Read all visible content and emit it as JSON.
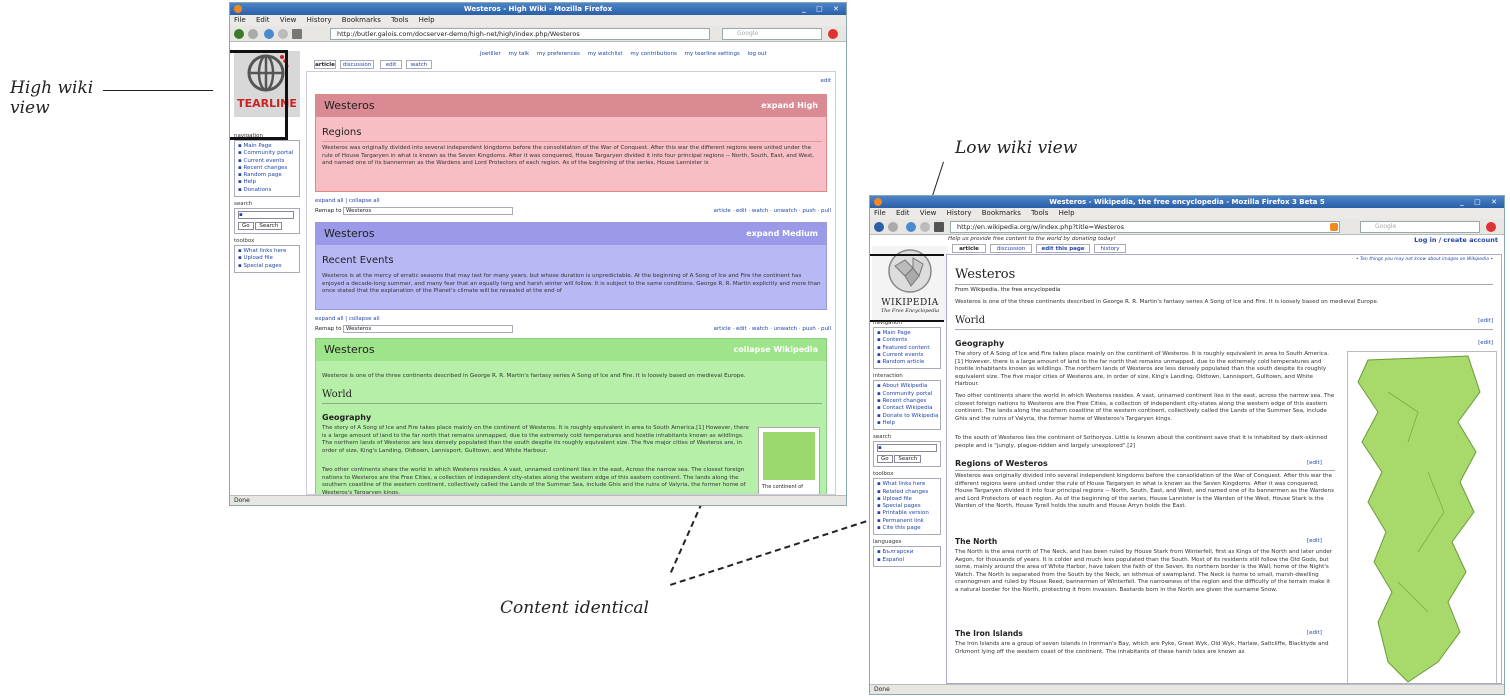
{
  "annotations": {
    "high_wiki": "High wiki view",
    "low_wiki": "Low wiki view",
    "content_identical": "Content identical"
  },
  "high_window": {
    "title": "Westeros - High Wiki - Mozilla Firefox",
    "menu": [
      "File",
      "Edit",
      "View",
      "History",
      "Bookmarks",
      "Tools",
      "Help"
    ],
    "url": "http://butler.galois.com/docserver-demo/high-net/high/index.php/Westeros",
    "search_placeholder": "Google",
    "user_links": [
      "Joetiller",
      "my talk",
      "my preferences",
      "my watchlist",
      "my contributions",
      "my tearline settings",
      "log out"
    ],
    "tabs": [
      "article",
      "discussion",
      "edit",
      "watch"
    ],
    "logo_text": "TEARLINE",
    "edit_link": "edit",
    "nav_header": "navigation",
    "nav_items": [
      "Main Page",
      "Community portal",
      "Current events",
      "Recent changes",
      "Random page",
      "Help",
      "Donations"
    ],
    "search_header": "search",
    "go_label": "Go",
    "search_label": "Search",
    "toolbox_header": "toolbox",
    "toolbox_items": [
      "What links here",
      "Upload file",
      "Special pages"
    ],
    "status": "Done",
    "high": {
      "title": "Westeros",
      "expand": "expand High",
      "heading": "Regions",
      "text": "Westeros was originally divided into several independent kingdoms before the consolidation of the War of Conquest. After this war the different regions were united under the rule of House Targaryen in what is known as the Seven Kingdoms. After it was conquered, House Targaryen divided it into four principal regions -- North, South, East, and West, and named one of its bannermen as the Wardens and Lord Protectors of each region. As of the beginning of the series, House Lannister is"
    },
    "expand_all": "expand all | collapse all",
    "remap_label": "Remap to",
    "remap_value": "Westeros",
    "remap_actions": "article · edit · watch · unwatch · push · pull",
    "medium": {
      "title": "Westeros",
      "expand": "expand Medium",
      "heading": "Recent Events",
      "text": "Westeros is at the mercy of erratic seasons that may last for many years, but whose duration is unpredictable. At the beginning of A Song of Ice and Fire the continent has enjoyed a decade-long summer, and many fear that an equally long and harsh winter will follow. It is subject to the same conditions. George R. R. Martin explicitly and more than once stated that the explanation of the Planet's climate will be revealed at the end of"
    },
    "low": {
      "title": "Westeros",
      "expand": "collapse Wikipedia",
      "intro": "Westeros is one of the three continents described in George R. R. Martin's fantasy series A Song of Ice and Fire. It is loosely based on medieval Europe.",
      "world": "World",
      "geo": "Geography",
      "geo_text": "The story of A Song of Ice and Fire takes place mainly on the continent of Westeros. It is roughly equivalent in area to South America.[1] However, there is a large amount of land to the far north that remains unmapped, due to the extremely cold temperatures and hostile inhabitants known as wildlings. The northern lands of Westeros are less densely populated than the south despite its roughly equivalent size. The five major cities of Westeros are, in order of size, King's Landing, Oldtown, Lannisport, Gulltown, and White Harbour.",
      "geo_text2": "Two other continents share the world in which Westeros resides. A vast, unnamed continent lies in the east, Across the narrow sea. The closest foreign nations to Westeros are the Free Cities, a collection of independent city-states along the western edge of this eastern continent. The lands along the southern coastline of the western continent, collectively called the Lands of the Summer Sea, include Ghis and the ruins of Valyria, the former home of Westeros's Targaryen kings.",
      "map_caption": "The continent of"
    }
  },
  "low_window": {
    "title": "Westeros - Wikipedia, the free encyclopedia - Mozilla Firefox 3 Beta 5",
    "menu": [
      "File",
      "Edit",
      "View",
      "History",
      "Bookmarks",
      "Tools",
      "Help"
    ],
    "url": "http://en.wikipedia.org/w/index.php?title=Westeros",
    "search_placeholder": "Google",
    "donate": "Help us provide free content to the world by donating today!",
    "login": "Log in / create account",
    "tabs": [
      "article",
      "discussion",
      "edit this page",
      "history"
    ],
    "tip": "• Ten things you may not know about images on Wikipedia •",
    "logo_text": "WIKIPEDIA",
    "logo_sub": "The Free Encyclopedia",
    "page_title": "Westeros",
    "from": "From Wikipedia, the free encyclopedia",
    "intro": "Westeros is one of the three continents described in George R. R. Martin's fantasy series A Song of Ice and Fire. It is loosely based on medieval Europe.",
    "world": "World",
    "edit": "[edit]",
    "geo": "Geography",
    "geo_text": "The story of A Song of Ice and Fire takes place mainly on the continent of Westeros. It is roughly equivalent in area to South America.[1] However, there is a large amount of land to the far north that remains unmapped, due to the extremely cold temperatures and hostile inhabitants known as wildlings. The northern lands of Westeros are less densely populated than the south despite its roughly equivalent size. The five major cities of Westeros are, in order of size, King's Landing, Oldtown, Lannisport, Gulltown, and White Harbour.",
    "geo_text2": "Two other continents share the world in which Westeros resides. A vast, unnamed continent lies in the east, across the narrow sea. The closest foreign nations to Westeros are the Free Cities, a collection of independent city-states along the western edge of this eastern continent. The lands along the southern coastline of the western continent, collectively called the Lands of the Summer Sea, include Ghis and the ruins of Valyria, the former home of Westeros's Targaryen kings.",
    "geo_text3": "To the south of Westeros lies the continent of Sothoryos. Little is known about the continent save that it is inhabited by dark-skinned people and is \"jungly, plague-ridden and largely unexplored\".[2]",
    "regions": "Regions of Westeros",
    "regions_text": "Westeros was originally divided into several independent kingdoms before the consolidation of the War of Conquest. After this war the different regions were united under the rule of House Targaryen in what is known as the Seven Kingdoms. After it was conquered, House Targaryen divided it into four principal regions -- North, South, East, and West, and named one of its bannermen as the Wardens and Lord Protectors of each region. As of the beginning of the series, House Lannister is the Warden of the West, House Stark is the Warden of the North, House Tyrell holds the south and House Arryn holds the East.",
    "north": "The North",
    "north_text": "The North is the area north of The Neck, and has been ruled by House Stark from Winterfell, first as Kings of the North and later under Aegon, for thousands of years. It is colder and much less populated than the South. Most of its residents still follow the Old Gods, but some, mainly around the area of White Harbor, have taken the faith of the Seven. Its northern border is the Wall, home of the Night's Watch. The North is separated from the South by the Neck, an isthmus of swampland. The Neck is home to small, marsh-dwelling crannogmen and ruled by House Reed, bannermen of Winterfell. The narrowness of the region and the difficulty of the terrain make it a natural border for the North, protecting it from invasion. Bastards born in the North are given the surname Snow.",
    "iron": "The Iron Islands",
    "iron_text": "The Iron Islands are a group of seven islands in Ironman's Bay, which are Pyke, Great Wyk, Old Wyk, Harlaw, Saltcliffe, Blacktyde and Orkmont lying off the western coast of the continent. The inhabitants of these harsh isles are known as",
    "nav_header": "navigation",
    "nav_items": [
      "Main Page",
      "Contents",
      "Featured content",
      "Current events",
      "Random article"
    ],
    "interaction_header": "interaction",
    "interaction_items": [
      "About Wikipedia",
      "Community portal",
      "Recent changes",
      "Contact Wikipedia",
      "Donate to Wikipedia",
      "Help"
    ],
    "search_header": "search",
    "go_label": "Go",
    "search_label": "Search",
    "toolbox_header": "toolbox",
    "toolbox_items": [
      "What links here",
      "Related changes",
      "Upload file",
      "Special pages",
      "Printable version",
      "Permanent link",
      "Cite this page"
    ],
    "languages_header": "languages",
    "languages_items": [
      "Български",
      "Español"
    ],
    "status": "Done"
  }
}
